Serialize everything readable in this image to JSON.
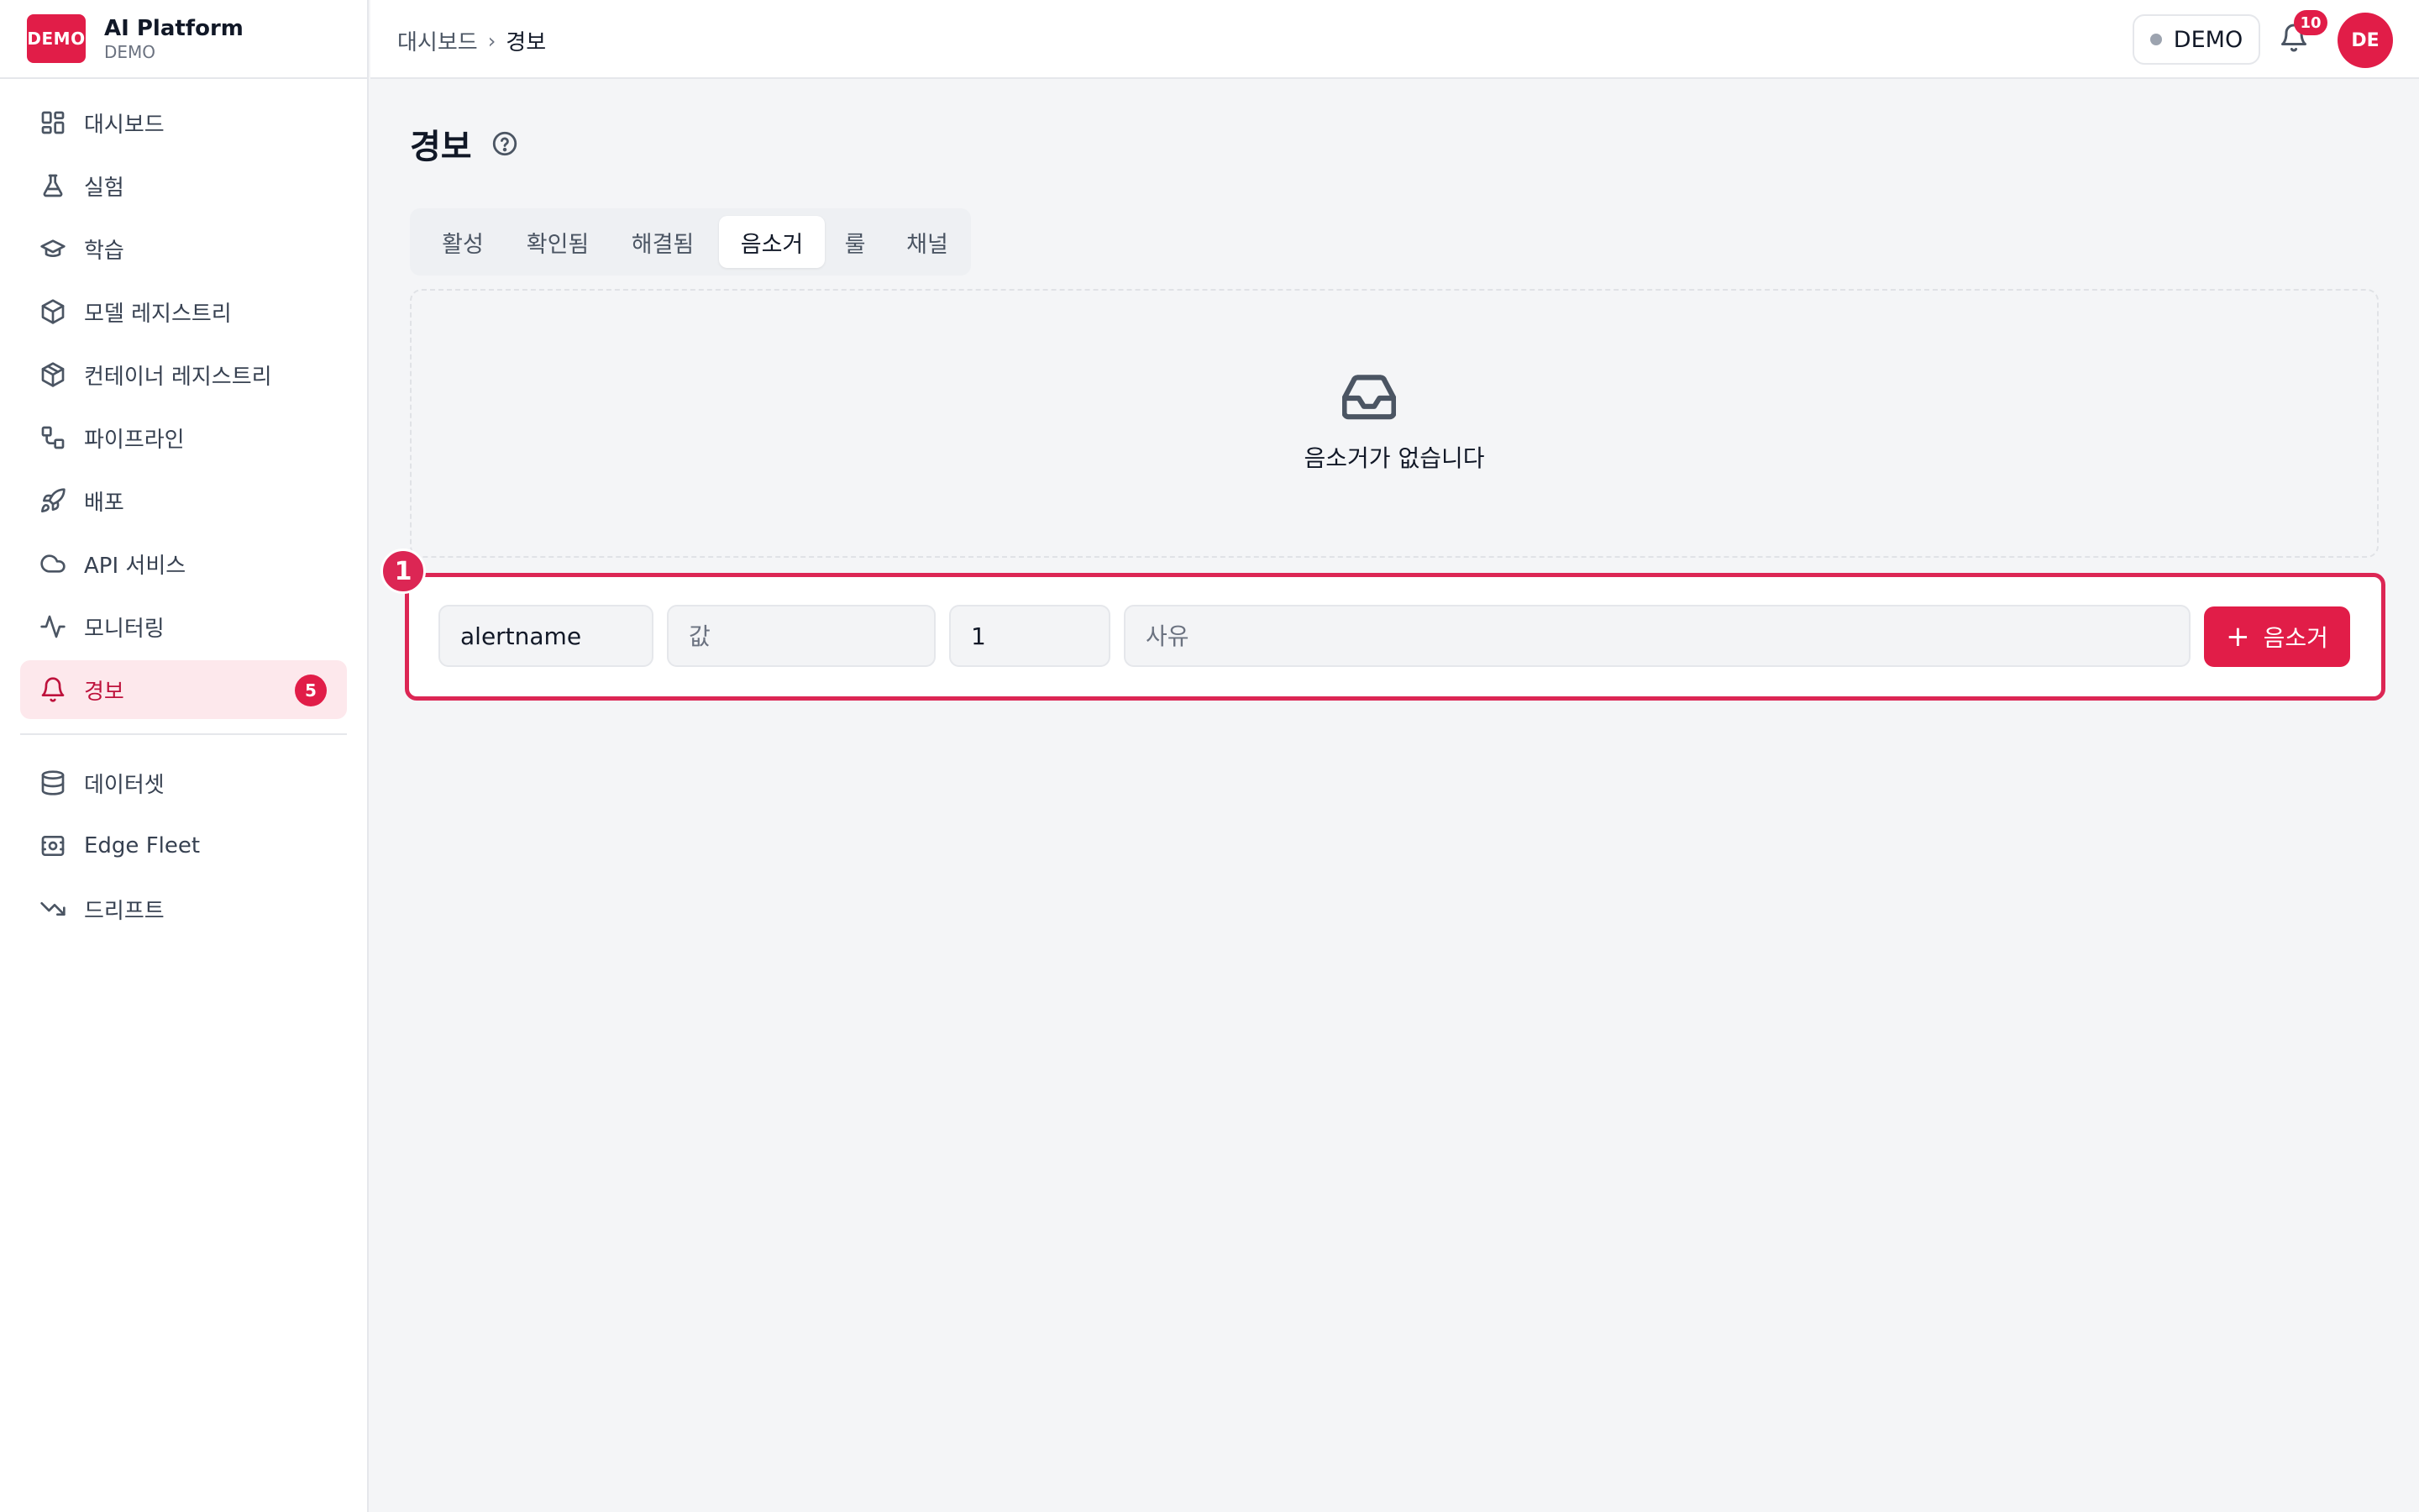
{
  "brand": {
    "logo": "DEMO",
    "title": "AI Platform",
    "subtitle": "DEMO"
  },
  "sidebar": {
    "items": [
      {
        "label": "대시보드",
        "icon": "dashboard-icon"
      },
      {
        "label": "실험",
        "icon": "flask-icon"
      },
      {
        "label": "학습",
        "icon": "graduation-cap-icon"
      },
      {
        "label": "모델 레지스트리",
        "icon": "box-icon"
      },
      {
        "label": "컨테이너 레지스트리",
        "icon": "package-icon"
      },
      {
        "label": "파이프라인",
        "icon": "workflow-icon"
      },
      {
        "label": "배포",
        "icon": "rocket-icon"
      },
      {
        "label": "API 서비스",
        "icon": "cloud-icon"
      },
      {
        "label": "모니터링",
        "icon": "activity-icon"
      },
      {
        "label": "경보",
        "icon": "bell-icon",
        "badge": "5",
        "active": true
      }
    ],
    "secondary": [
      {
        "label": "데이터셋",
        "icon": "database-icon"
      },
      {
        "label": "Edge Fleet",
        "icon": "edge-device-icon"
      },
      {
        "label": "드리프트",
        "icon": "trending-down-icon"
      }
    ]
  },
  "topbar": {
    "breadcrumb": {
      "parent": "대시보드",
      "current": "경보"
    },
    "env": "DEMO",
    "notifications": "10",
    "avatar": "DE"
  },
  "page": {
    "title": "경보",
    "tabs": [
      "활성",
      "확인됨",
      "해결됨",
      "음소거",
      "룰",
      "채널"
    ],
    "active_tab": "음소거",
    "empty_message": "음소거가 없습니다"
  },
  "form": {
    "marker": "1",
    "name_value": "alertname",
    "value_placeholder": "값",
    "duration_value": "1",
    "reason_placeholder": "사유",
    "submit_label": "음소거"
  },
  "colors": {
    "accent": "#e11d48",
    "highlight": "#dc2654"
  }
}
